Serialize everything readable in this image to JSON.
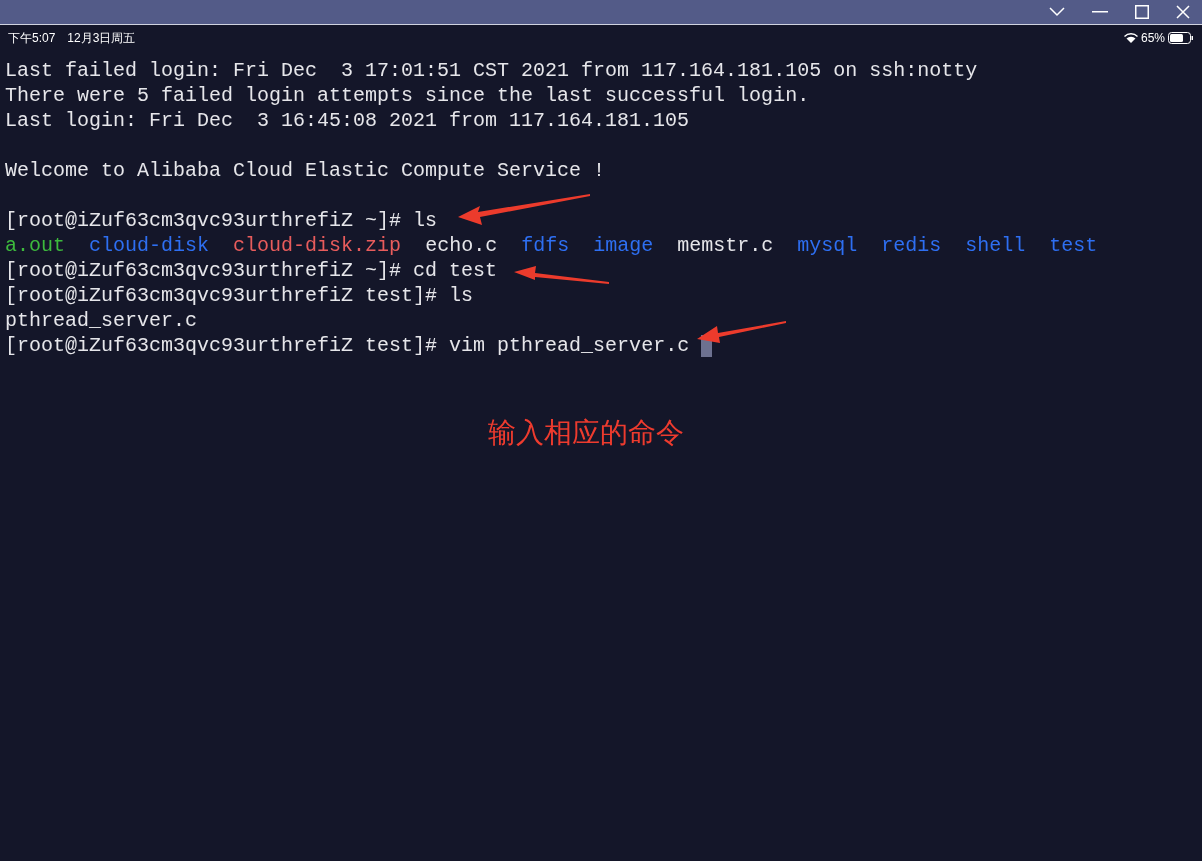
{
  "status_bar": {
    "time": "下午5:07",
    "date": "12月3日周五",
    "battery": "65%"
  },
  "terminal": {
    "lines": [
      {
        "kind": "text",
        "text": "Last failed login: Fri Dec  3 17:01:51 CST 2021 from 117.164.181.105 on ssh:notty"
      },
      {
        "kind": "text",
        "text": "There were 5 failed login attempts since the last successful login."
      },
      {
        "kind": "text",
        "text": "Last login: Fri Dec  3 16:45:08 2021 from 117.164.181.105"
      },
      {
        "kind": "blank"
      },
      {
        "kind": "text",
        "text": "Welcome to Alibaba Cloud Elastic Compute Service !"
      },
      {
        "kind": "blank"
      },
      {
        "kind": "prompt",
        "prompt": "[root@iZuf63cm3qvc93urthrefiZ ~]#",
        "command": "ls",
        "cursor": false
      },
      {
        "kind": "listing",
        "items": [
          {
            "name": "a.out",
            "kind": "executable"
          },
          {
            "name": "cloud-disk",
            "kind": "directory"
          },
          {
            "name": "cloud-disk.zip",
            "kind": "archive"
          },
          {
            "name": "echo.c",
            "kind": "file"
          },
          {
            "name": "fdfs",
            "kind": "directory"
          },
          {
            "name": "image",
            "kind": "directory"
          },
          {
            "name": "memstr.c",
            "kind": "file"
          },
          {
            "name": "mysql",
            "kind": "directory"
          },
          {
            "name": "redis",
            "kind": "directory"
          },
          {
            "name": "shell",
            "kind": "directory"
          },
          {
            "name": "test",
            "kind": "directory"
          }
        ]
      },
      {
        "kind": "prompt",
        "prompt": "[root@iZuf63cm3qvc93urthrefiZ ~]#",
        "command": "cd test",
        "cursor": false
      },
      {
        "kind": "prompt",
        "prompt": "[root@iZuf63cm3qvc93urthrefiZ test]#",
        "command": "ls",
        "cursor": false
      },
      {
        "kind": "text",
        "text": "pthread_server.c"
      },
      {
        "kind": "prompt",
        "prompt": "[root@iZuf63cm3qvc93urthrefiZ test]#",
        "command": "vim pthread_server.c",
        "cursor": true
      }
    ]
  },
  "annotation": {
    "text": "输入相应的命令"
  }
}
